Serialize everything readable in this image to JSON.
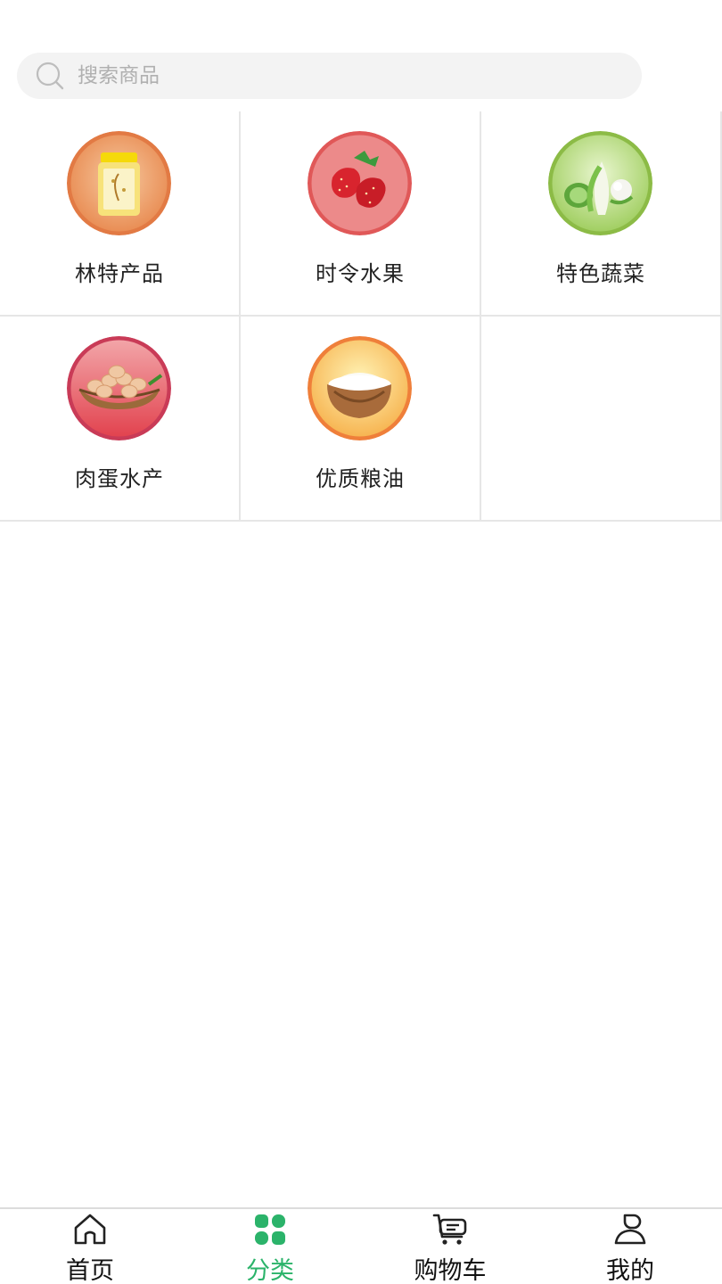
{
  "search": {
    "placeholder": "搜索商品"
  },
  "categories": [
    {
      "label": "林特产品",
      "icon": "honey-jar-icon"
    },
    {
      "label": "时令水果",
      "icon": "strawberry-icon"
    },
    {
      "label": "特色蔬菜",
      "icon": "cabbage-icon"
    },
    {
      "label": "肉蛋水产",
      "icon": "eggs-basket-icon"
    },
    {
      "label": "优质粮油",
      "icon": "rice-bowl-icon"
    }
  ],
  "tabbar": {
    "items": [
      {
        "label": "首页",
        "icon": "home-icon"
      },
      {
        "label": "分类",
        "icon": "category-icon",
        "active": true
      },
      {
        "label": "购物车",
        "icon": "cart-icon"
      },
      {
        "label": "我的",
        "icon": "user-icon"
      }
    ]
  },
  "colors": {
    "accent": "#2bb36a",
    "divider": "#e6e6e6",
    "search_bg": "#f3f3f3"
  }
}
